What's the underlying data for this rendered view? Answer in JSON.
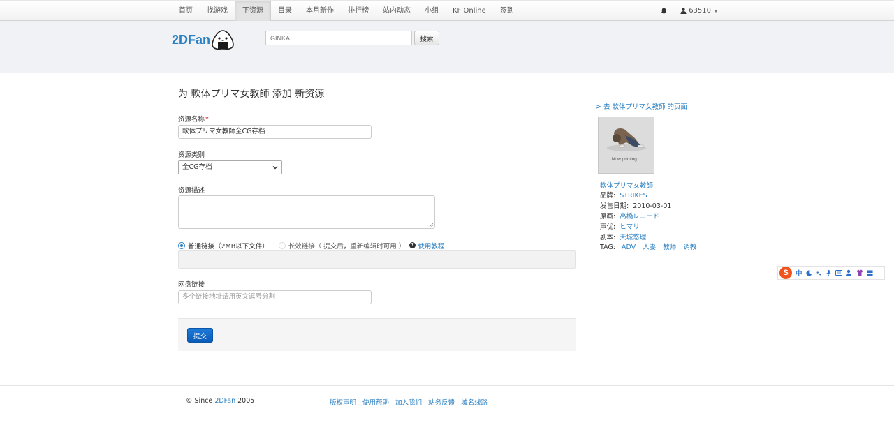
{
  "nav": {
    "items": [
      {
        "label": "首页",
        "active": false
      },
      {
        "label": "找游戏",
        "active": false
      },
      {
        "label": "下资源",
        "active": true
      },
      {
        "label": "目录",
        "active": false
      },
      {
        "label": "本月新作",
        "active": false
      },
      {
        "label": "排行榜",
        "active": false
      },
      {
        "label": "站内动态",
        "active": false
      },
      {
        "label": "小组",
        "active": false
      },
      {
        "label": "KF Online",
        "active": false
      },
      {
        "label": "签到",
        "active": false
      }
    ],
    "user": "63510",
    "bell_icon": "bell-icon",
    "user_icon": "user-icon"
  },
  "header": {
    "logo": "2DFan",
    "search_placeholder": "GINKA",
    "search_button": "搜索"
  },
  "form": {
    "title": "为 軟体プリマ女教師 添加 新资源",
    "name_label": "资源名称",
    "required_mark": "*",
    "name_value": "軟体プリマ女教師全CG存档",
    "category_label": "资源类别",
    "category_value": "全CG存档",
    "desc_label": "资源描述",
    "desc_value": "",
    "radio_normal": "普通链接（2MB以下文件）",
    "radio_long": "长效链接（ 提交后，重新编辑时可用 ）",
    "help_link": "使用教程",
    "netdisk_label": "网盘链接",
    "netdisk_placeholder": "多个链接地址请用英文逗号分割",
    "submit": "提交"
  },
  "sidebar": {
    "goto_link": "> 去 軟体プリマ女教師 的页面",
    "cover_text": "Now printing...",
    "game_title": "軟体プリマ女教師",
    "brand_key": "品牌:",
    "brand": "STRIKES",
    "date_key": "发售日期:",
    "date": "2010-03-01",
    "art_key": "原画:",
    "art": "高橋レコード",
    "cv_key": "声优:",
    "cv": "ヒマリ",
    "writer_key": "剧本:",
    "writer": "天城悠理",
    "tag_key": "TAG:",
    "tags": [
      "ADV",
      "人妻",
      "教师",
      "调教"
    ]
  },
  "ime": {
    "logo": "S",
    "mode": "中"
  },
  "footer": {
    "since": "© Since",
    "brand": "2DFan",
    "year": "2005",
    "links": [
      "版权声明",
      "使用帮助",
      "加入我们",
      "站务反馈",
      "域名线路"
    ]
  },
  "colors": {
    "link": "#2a7fc1",
    "primary_button": "#0b5cb8",
    "header_band": "#f0f2f5"
  }
}
